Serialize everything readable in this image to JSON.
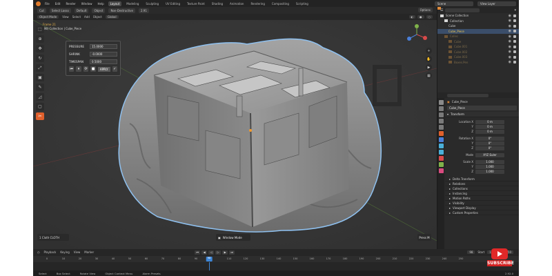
{
  "menu": {
    "items": [
      "File",
      "Edit",
      "Render",
      "Window",
      "Help"
    ],
    "tabs": [
      "Layout",
      "Modeling",
      "Sculpting",
      "UV Editing",
      "Texture Paint",
      "Shading",
      "Animation",
      "Rendering",
      "Compositing",
      "Scripting"
    ],
    "active_tab": "Layout",
    "scene": "Scene",
    "view_layer": "View Layer"
  },
  "tool_header": {
    "drag": "Cut",
    "select_mode": "Select Lasso",
    "orientation": "Default",
    "pivot": "Object",
    "snap": "Non-Destructive",
    "version": "2.91",
    "options": "Options"
  },
  "viewport_header": {
    "mode": "Object Mode",
    "menus": [
      "View",
      "Select",
      "Add",
      "Object"
    ],
    "transform": "Global"
  },
  "viewport": {
    "frame_label": "Frame 21",
    "collection_label": "(98) Collection | Cube_Piece",
    "operator_panel": "1  Cloth  CLOTH",
    "window_mode": "Window Mode",
    "press_m": "Press M"
  },
  "sim_panel": {
    "rows": [
      {
        "label": "PRESSURE",
        "value": "15.0000"
      },
      {
        "label": "SHRINK",
        "value": "-0.0000"
      },
      {
        "label": "TIMESPAN",
        "value": "0.5000"
      }
    ],
    "apply_label": "APPLY"
  },
  "outliner": {
    "rows": [
      {
        "label": "Scene Collection",
        "indent": 0,
        "type": "coll",
        "state": "normal"
      },
      {
        "label": "Collection",
        "indent": 1,
        "type": "coll",
        "state": "normal"
      },
      {
        "label": "Cube",
        "indent": 2,
        "type": "mesh",
        "state": "normal"
      },
      {
        "label": "Cube_Piece",
        "indent": 2,
        "type": "mesh",
        "state": "selected"
      },
      {
        "label": "Collec",
        "indent": 1,
        "type": "dimmesh",
        "state": "dim"
      },
      {
        "label": "Cube",
        "indent": 2,
        "type": "dimmesh",
        "state": "dim"
      },
      {
        "label": "Cube.001",
        "indent": 2,
        "type": "dimmesh",
        "state": "dim"
      },
      {
        "label": "Cube.002",
        "indent": 2,
        "type": "dimmesh",
        "state": "dim"
      },
      {
        "label": "Cube.003",
        "indent": 2,
        "type": "dimmesh",
        "state": "dim"
      },
      {
        "label": "Boxes.Pen",
        "indent": 2,
        "type": "dimmesh",
        "state": "dim"
      }
    ]
  },
  "properties": {
    "object_title": "Cube_Piece",
    "name_value": "Cube_Piece",
    "transform_label": "Transform",
    "location": {
      "label": "Location X",
      "values": [
        "0 m",
        "0 m",
        "0 m"
      ]
    },
    "rotation": {
      "label": "Rotation X",
      "values": [
        "0°",
        "0°",
        "0°"
      ]
    },
    "rotation_mode": {
      "label": "Mode",
      "value": "XYZ Euler"
    },
    "scale": {
      "label": "Scale X",
      "values": [
        "1.000",
        "1.000",
        "1.000"
      ]
    },
    "axes": [
      "Y",
      "Z"
    ],
    "subsections": [
      "Delta Transform",
      "Relations",
      "Collections",
      "Instancing",
      "Motion Paths",
      "Visibility",
      "Viewport Display",
      "Custom Properties"
    ]
  },
  "timeline": {
    "menus": [
      "Playback",
      "Keying",
      "View",
      "Marker"
    ],
    "current_frame": "98",
    "start_label": "Start",
    "start_value": "1",
    "end_label": "End",
    "end_value": "250",
    "ticks": [
      "0",
      "10",
      "20",
      "30",
      "40",
      "50",
      "60",
      "70",
      "80",
      "90",
      "110",
      "120",
      "130",
      "140",
      "150",
      "160",
      "170",
      "180",
      "190",
      "200",
      "210",
      "220",
      "230",
      "240",
      "250"
    ]
  },
  "statusbar": {
    "items": [
      "Select",
      "Box Select",
      "Rotate View",
      "Object Context Menu",
      "Alarm Presets"
    ],
    "version": "2.92.0"
  },
  "badge": {
    "text": "SUBSCRIBE"
  },
  "colors": {
    "accent": "#e0602c",
    "selection_outline": "#8fc1f0",
    "mesh": "#8c8c8c",
    "badge_red": "#e02828"
  }
}
